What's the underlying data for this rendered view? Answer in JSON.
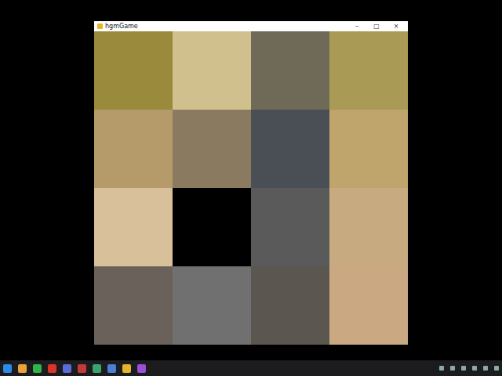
{
  "window": {
    "title": "hgmGame",
    "controls": [
      "–",
      "□",
      "×"
    ]
  },
  "puzzle": {
    "tiles": [
      {
        "empty": false
      },
      {
        "empty": false
      },
      {
        "empty": false
      },
      {
        "empty": false
      },
      {
        "empty": false
      },
      {
        "empty": false
      },
      {
        "empty": false
      },
      {
        "empty": false
      },
      {
        "empty": false
      },
      {
        "empty": true
      },
      {
        "empty": false
      },
      {
        "empty": false
      },
      {
        "empty": false
      },
      {
        "empty": false
      },
      {
        "empty": false
      },
      {
        "empty": false
      }
    ]
  }
}
